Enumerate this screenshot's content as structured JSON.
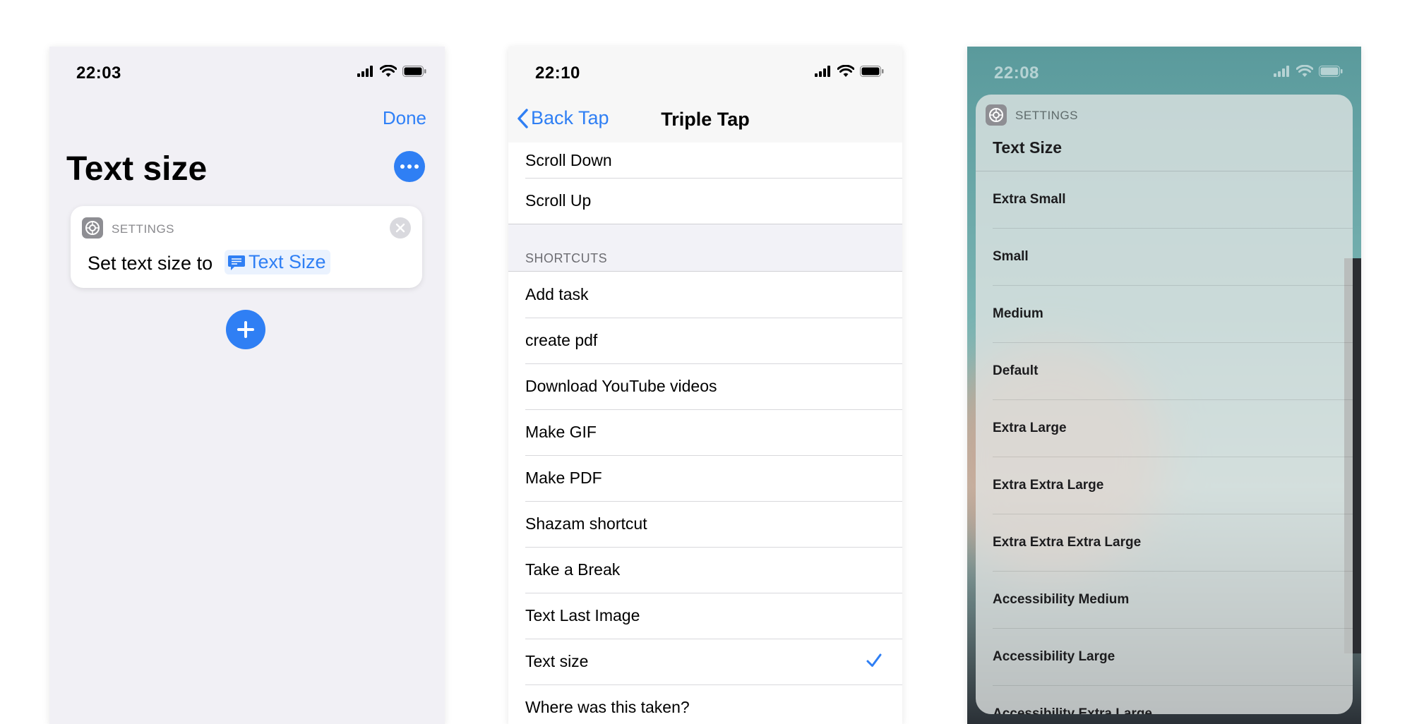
{
  "panel1": {
    "status_time": "22:03",
    "done_label": "Done",
    "title": "Text size",
    "card": {
      "app_label": "SETTINGS",
      "text": "Set text size to",
      "token_label": "Text Size"
    },
    "icons": [
      "more-icon",
      "gear-icon",
      "close-icon",
      "text-bubble-icon",
      "plus-icon"
    ]
  },
  "panel2": {
    "status_time": "22:10",
    "back_label": "Back Tap",
    "title": "Triple Tap",
    "top_items": [
      "Scroll Down",
      "Scroll Up"
    ],
    "section_header": "SHORTCUTS",
    "shortcuts": [
      "Add task",
      "create pdf",
      "Download YouTube videos",
      "Make GIF",
      "Make PDF",
      "Shazam shortcut",
      "Take a Break",
      "Text Last Image",
      "Text size",
      "Where was this taken?"
    ],
    "selected": "Text size",
    "accent": "#2f7ff4"
  },
  "panel3": {
    "status_time": "22:08",
    "app_label": "SETTINGS",
    "title": "Text Size",
    "options": [
      "Extra Small",
      "Small",
      "Medium",
      "Default",
      "Extra Large",
      "Extra Extra Large",
      "Extra Extra Extra Large",
      "Accessibility Medium",
      "Accessibility Large",
      "Accessibility Extra Large"
    ]
  }
}
